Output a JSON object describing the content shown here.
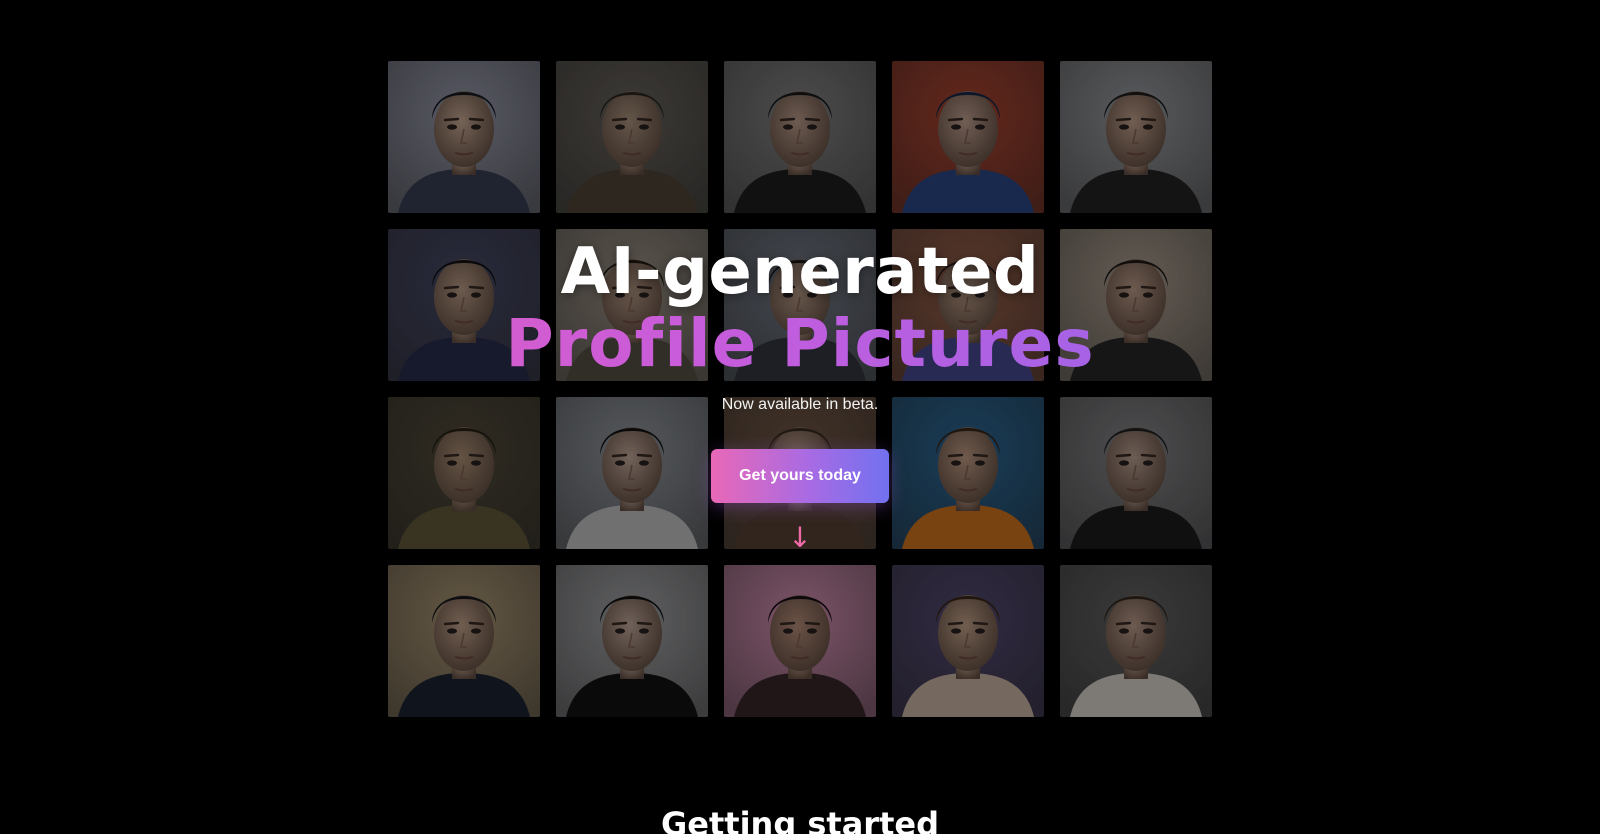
{
  "hero": {
    "title_line1": "AI-generated",
    "title_line2": "Profile Pictures",
    "subtitle": "Now available in beta.",
    "cta_label": "Get yours today",
    "arrow_glyph": "↓"
  },
  "section": {
    "title": "Getting started"
  },
  "colors": {
    "background": "#000000",
    "gradient_start": "#f05fb2",
    "gradient_mid": "#c65cdc",
    "gradient_end": "#7b6cf2",
    "arrow": "#f06aa8"
  },
  "portraits": [
    {
      "bg": "#a3a6b8",
      "skin": "#d7b6a0",
      "hair": "#1a1c22",
      "cloth": "#3a4259"
    },
    {
      "bg": "#6f6a63",
      "skin": "#b89e88",
      "hair": "#2f2a26",
      "cloth": "#55493d"
    },
    {
      "bg": "#8d8d8d",
      "skin": "#c8a895",
      "hair": "#1c1c1c",
      "cloth": "#202020"
    },
    {
      "bg": "#b84934",
      "skin": "#d0ad9c",
      "hair": "#1a2c4a",
      "cloth": "#2f4c8e"
    },
    {
      "bg": "#a5a7ac",
      "skin": "#d1ad98",
      "hair": "#1e1e1e",
      "cloth": "#262626"
    },
    {
      "bg": "#4d4f6e",
      "skin": "#c8a890",
      "hair": "#141418",
      "cloth": "#2c3154"
    },
    {
      "bg": "#a79c8f",
      "skin": "#c6a792",
      "hair": "#241d16",
      "cloth": "#5b5448"
    },
    {
      "bg": "#7c8390",
      "skin": "#c9aa95",
      "hair": "#1d1d1d",
      "cloth": "#363b44"
    },
    {
      "bg": "#a3674f",
      "skin": "#caa890",
      "hair": "#2d2221",
      "cloth": "#4b4f9a"
    },
    {
      "bg": "#b8a99a",
      "skin": "#c9a793",
      "hair": "#201a17",
      "cloth": "#292929"
    },
    {
      "bg": "#58503f",
      "skin": "#b89a7d",
      "hair": "#2a2218",
      "cloth": "#6a6040"
    },
    {
      "bg": "#9ea3aa",
      "skin": "#d2b6a6",
      "hair": "#141414",
      "cloth": "#cfcfcf"
    },
    {
      "bg": "#7a5e4a",
      "skin": "#c4a58c",
      "hair": "#3a2e24",
      "cloth": "#5b4636"
    },
    {
      "bg": "#2f6fa0",
      "skin": "#cfa88e",
      "hair": "#3b2a1d",
      "cloth": "#e07a20"
    },
    {
      "bg": "#8f8f92",
      "skin": "#c8ac9c",
      "hair": "#242424",
      "cloth": "#1e1e1e"
    },
    {
      "bg": "#b8a27d",
      "skin": "#d0ae95",
      "hair": "#1b1b20",
      "cloth": "#1d2637"
    },
    {
      "bg": "#b0b1b4",
      "skin": "#d0b6a6",
      "hair": "#141414",
      "cloth": "#141414"
    },
    {
      "bg": "#e39abf",
      "skin": "#c69883",
      "hair": "#1a1214",
      "cloth": "#3c2a2e"
    },
    {
      "bg": "#5a4f7a",
      "skin": "#d2ae94",
      "hair": "#3e2c1c",
      "cloth": "#d8c2b0"
    },
    {
      "bg": "#6b6b6b",
      "skin": "#c8a895",
      "hair": "#3a2c22",
      "cloth": "#e6e0d6"
    }
  ]
}
